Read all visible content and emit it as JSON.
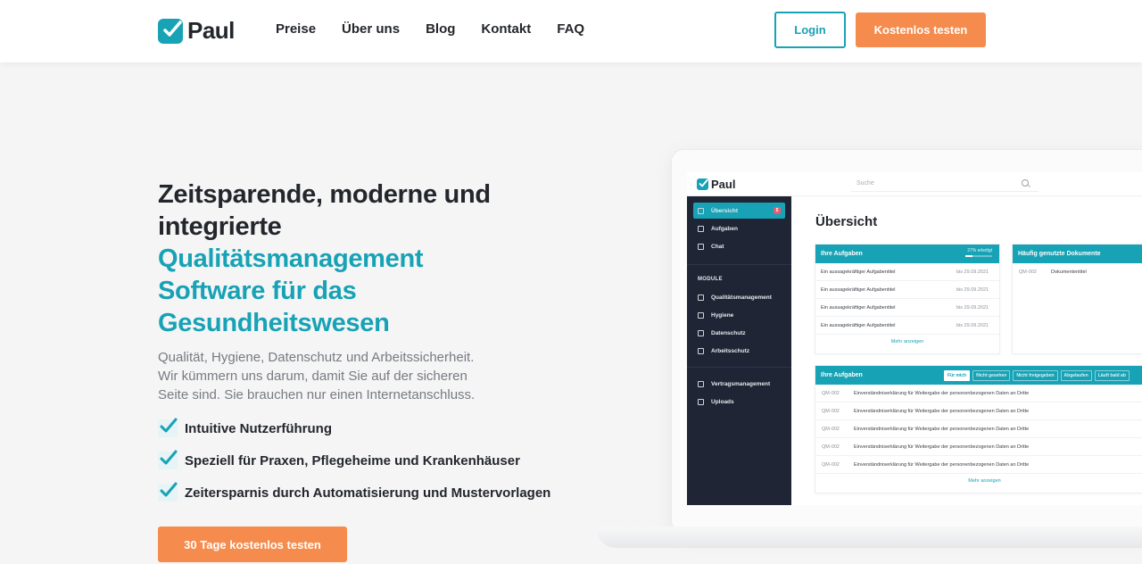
{
  "header": {
    "logo_text": "Paul",
    "nav": [
      "Preise",
      "Über uns",
      "Blog",
      "Kontakt",
      "FAQ"
    ],
    "login_label": "Login",
    "trial_label": "Kostenlos testen"
  },
  "hero": {
    "title_dark_1": "Zeitsparende, moderne und",
    "title_dark_2": "integrierte",
    "title_teal_1": "Qualitätsmanagement",
    "title_teal_2": "Software für das",
    "title_teal_3": "Gesundheitswesen",
    "subtitle_1": "Qualität, Hygiene, Datenschutz und Arbeitssicherheit.",
    "subtitle_2": "Wir kümmern uns darum, damit Sie auf der sicheren",
    "subtitle_3": "Seite sind. Sie brauchen nur einen Internetanschluss.",
    "features": [
      "Intuitive Nutzerführung",
      "Speziell für Praxen, Pflegeheime und Krankenhäuser",
      "Zeitersparnis durch Automatisierung und Mustervorlagen"
    ],
    "cta_label": "30 Tage kostenlos testen"
  },
  "app": {
    "logo_text": "Paul",
    "search_placeholder": "Suche",
    "sidebar": {
      "top_items": [
        {
          "label": "Übersicht",
          "badge": "5",
          "icon": "home-icon"
        },
        {
          "label": "Aufgaben",
          "icon": "clipboard-icon"
        },
        {
          "label": "Chat",
          "icon": "chat-icon"
        }
      ],
      "modules_heading": "MODULE",
      "module_items": [
        {
          "label": "Qualitätsmanagement",
          "icon": "heart-icon"
        },
        {
          "label": "Hygiene",
          "icon": "bottle-icon"
        },
        {
          "label": "Datenschutz",
          "icon": "lock-icon"
        },
        {
          "label": "Arbeitsschutz",
          "icon": "briefcase-icon"
        }
      ],
      "bottom_items": [
        {
          "label": "Vertragsmanagement",
          "icon": "document-icon"
        },
        {
          "label": "Uploads",
          "icon": "upload-icon"
        }
      ]
    },
    "main_title": "Übersicht",
    "tasks_card": {
      "title": "Ihre Aufgaben",
      "progress_text": "27% erledigt",
      "progress_value": 0.27,
      "rows": [
        {
          "title": "Ein aussagekräftiger Aufgabentitel",
          "due": "bis 29.09.2021"
        },
        {
          "title": "Ein aussagekräftiger Aufgabentitel",
          "due": "bis 29.09.2021"
        },
        {
          "title": "Ein aussagekräftiger Aufgabentitel",
          "due": "bis 29.09.2021"
        },
        {
          "title": "Ein aussagekräftiger Aufgabentitel",
          "due": "bis 29.09.2021"
        }
      ],
      "more_label": "Mehr anzeigen"
    },
    "docs_card": {
      "title": "Häufig genutzte Dokumente",
      "rows": [
        {
          "code": "QM-002",
          "name": "Dokumententitel"
        }
      ]
    },
    "tasks_card_2": {
      "title": "Ihre Aufgaben",
      "filters": [
        "Für mich",
        "Nicht gesehen",
        "Nicht freigegeben",
        "Abgelaufen",
        "Läuft bald ab"
      ],
      "rows": [
        {
          "code": "QM-002",
          "text": "Einverständniserklärung für Weitergabe der personenbezogenen Daten an Dritte"
        },
        {
          "code": "QM-002",
          "text": "Einverständniserklärung für Weitergabe der personenbezogenen Daten an Dritte"
        },
        {
          "code": "QM-002",
          "text": "Einverständniserklärung für Weitergabe der personenbezogenen Daten an Dritte"
        },
        {
          "code": "QM-002",
          "text": "Einverständniserklärung für Weitergabe der personenbezogenen Daten an Dritte"
        },
        {
          "code": "QM-002",
          "text": "Einverständniserklärung für Weitergabe der personenbezogenen Daten an Dritte"
        }
      ],
      "more_label": "Mehr anzeigen"
    }
  },
  "colors": {
    "teal": "#17a2b5",
    "orange": "#f58b4c",
    "dark_text": "#23262b",
    "sidebar": "#1f2535"
  }
}
